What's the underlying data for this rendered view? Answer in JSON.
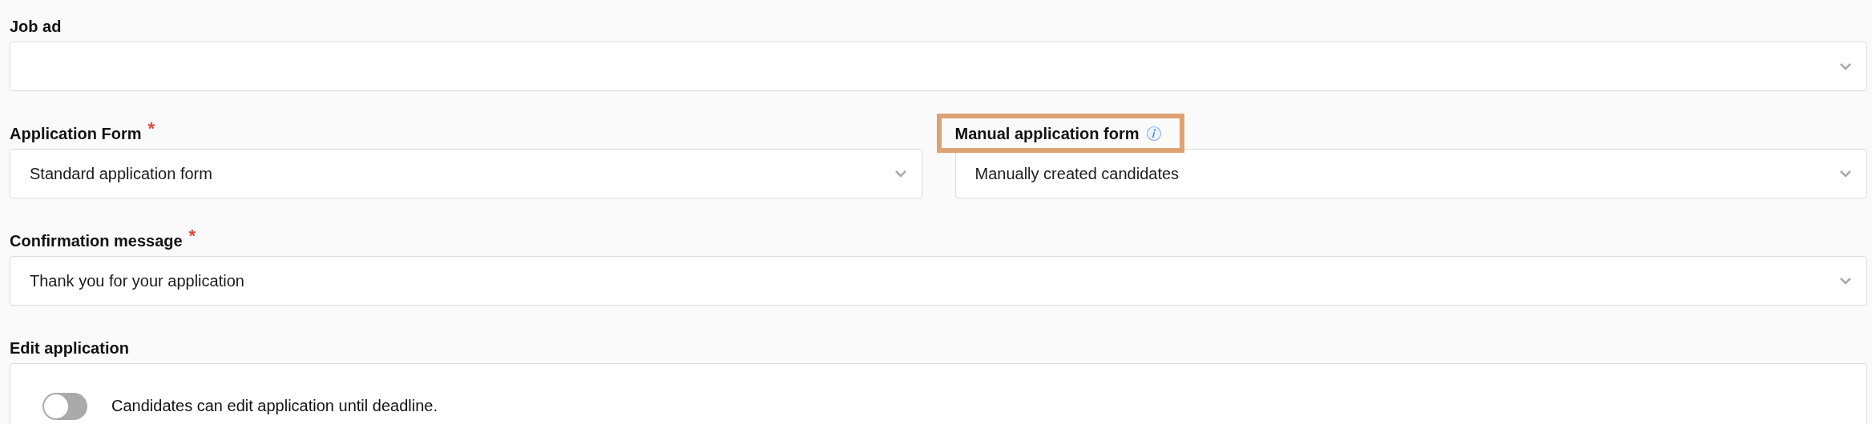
{
  "sections": [
    {
      "kind": "select",
      "fields": [
        {
          "label": "Job ad"
        }
      ]
    },
    {
      "kind": "select",
      "fields": [
        {
          "label": "Application Form",
          "required_mark": "*",
          "value": "Standard application form"
        },
        {
          "label": "Manual application form",
          "info": true,
          "highlighted": true,
          "value": "Manually created candidates"
        }
      ]
    },
    {
      "kind": "select",
      "fields": [
        {
          "label": "Confirmation message",
          "required_mark": "*",
          "value": "Thank you for your application"
        }
      ]
    },
    {
      "kind": "toggle",
      "label": "Edit application",
      "toggle": {
        "on": false,
        "text": "Candidates can edit application until deadline."
      }
    }
  ]
}
